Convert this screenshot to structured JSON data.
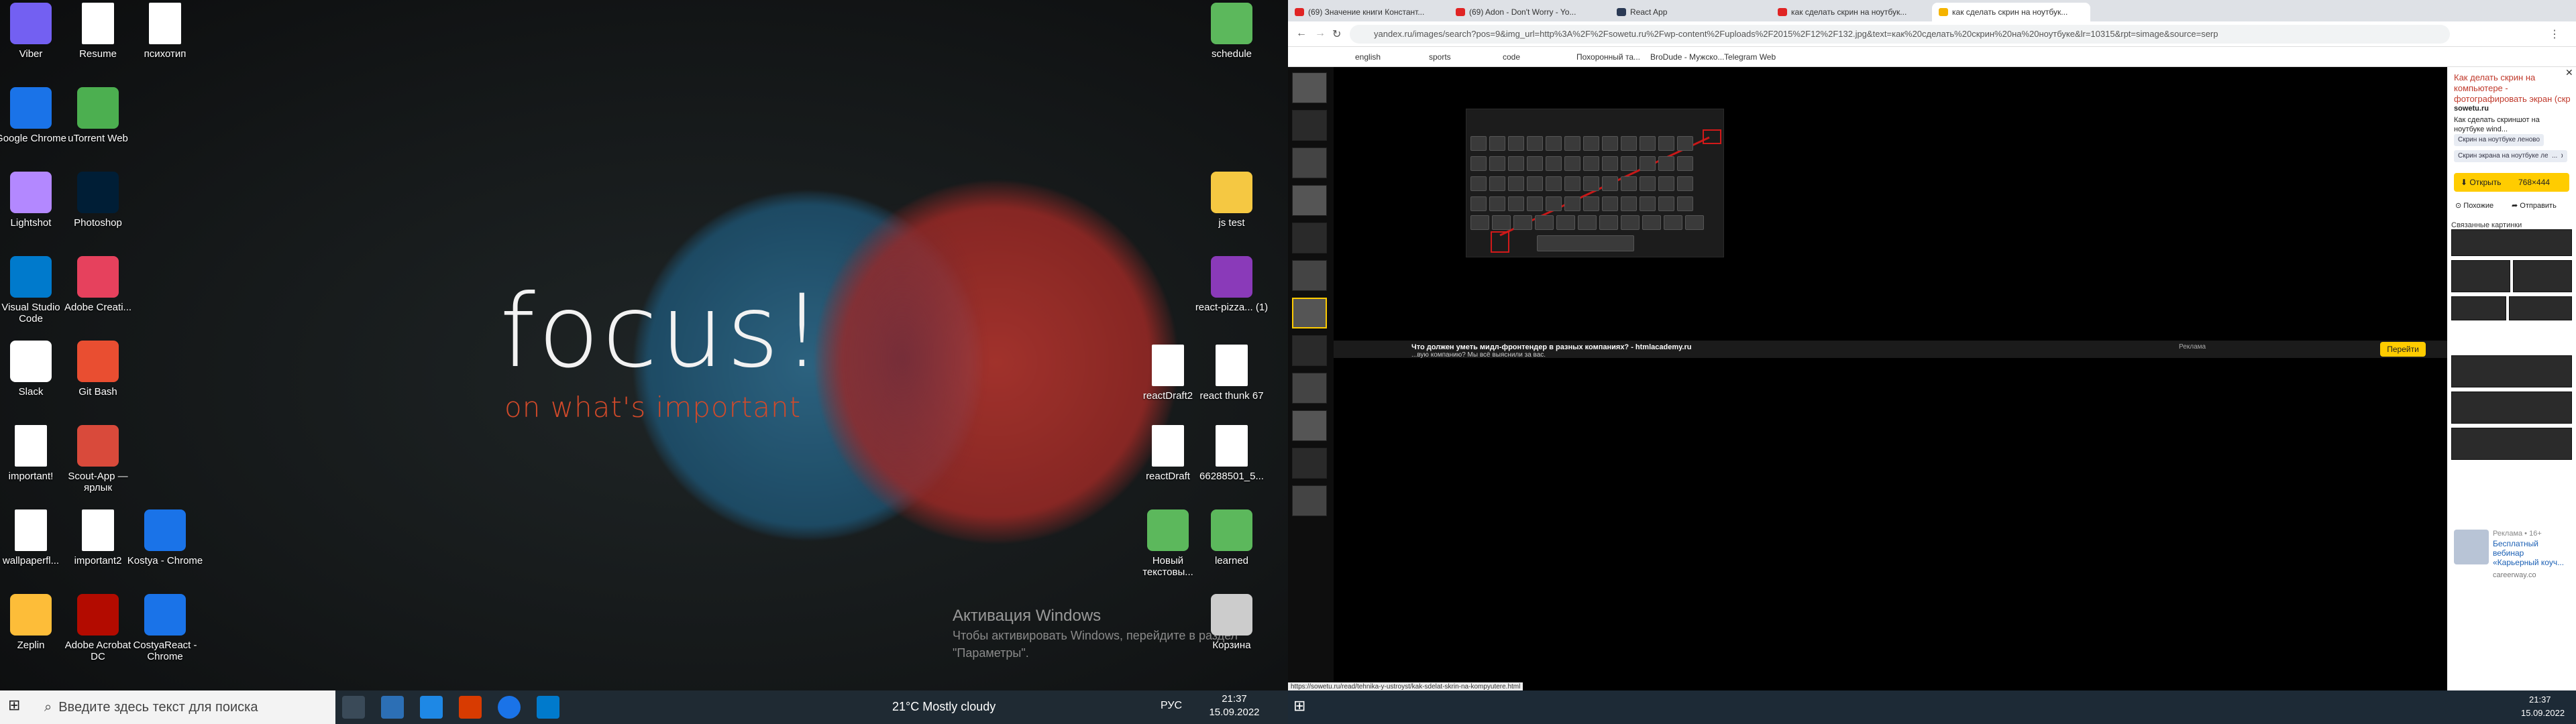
{
  "left_screen": {
    "wallpaper": {
      "title": "focus!",
      "subtitle": "on what's important"
    },
    "activation": {
      "title": "Активация Windows",
      "text": "Чтобы активировать Windows, перейдите в раздел \"Параметры\"."
    },
    "icons": [
      {
        "label": "Viber",
        "icon": "viber-icon",
        "color": "#7360f2"
      },
      {
        "label": "Resume",
        "icon": "docx-icon",
        "color": "#ffffff"
      },
      {
        "label": "психотип",
        "icon": "docx-icon",
        "color": "#ffffff"
      },
      {
        "label": "Google Chrome",
        "icon": "chrome-icon",
        "color": "#1a73e8"
      },
      {
        "label": "uTorrent Web",
        "icon": "utorrent-icon",
        "color": "#4caf50"
      },
      {
        "label": "Lightshot",
        "icon": "lightshot-icon",
        "color": "#b388ff"
      },
      {
        "label": "Photoshop",
        "icon": "photoshop-icon",
        "color": "#001e36"
      },
      {
        "label": "Visual Studio Code",
        "icon": "vscode-icon",
        "color": "#007acc"
      },
      {
        "label": "Adobe Creati...",
        "icon": "adobe-cc-icon",
        "color": "#e6415d"
      },
      {
        "label": "Slack",
        "icon": "slack-icon",
        "color": "#ffffff"
      },
      {
        "label": "Git Bash",
        "icon": "git-bash-icon",
        "color": "#e94e31"
      },
      {
        "label": "important!",
        "icon": "docx-icon",
        "color": "#ffffff"
      },
      {
        "label": "Scout-App — ярлык",
        "icon": "scout-app-icon",
        "color": "#d94a3b"
      },
      {
        "label": "wallpaperfl...",
        "icon": "image-file-icon",
        "color": "#ffffff"
      },
      {
        "label": "important2",
        "icon": "docx-icon",
        "color": "#ffffff"
      },
      {
        "label": "Kostya - Chrome",
        "icon": "chrome-icon",
        "color": "#1a73e8"
      },
      {
        "label": "Zeplin",
        "icon": "zeplin-icon",
        "color": "#fdbd39"
      },
      {
        "label": "Adobe Acrobat DC",
        "icon": "acrobat-icon",
        "color": "#b30b00"
      },
      {
        "label": "CostyaReact - Chrome",
        "icon": "chrome-icon",
        "color": "#1a73e8"
      },
      {
        "label": "schedule",
        "icon": "schedule-icon",
        "color": "#5cb85c"
      },
      {
        "label": "js test",
        "icon": "folder-icon",
        "color": "#f5c842"
      },
      {
        "label": "react-pizza... (1)",
        "icon": "rar-icon",
        "color": "#8a3ab9"
      },
      {
        "label": "reactDraft2",
        "icon": "docx-icon",
        "color": "#ffffff"
      },
      {
        "label": "react thunk 67",
        "icon": "docx-icon",
        "color": "#ffffff"
      },
      {
        "label": "reactDraft",
        "icon": "docx-icon",
        "color": "#ffffff"
      },
      {
        "label": "66288501_5...",
        "icon": "docx-icon",
        "color": "#ffffff"
      },
      {
        "label": "Новый текстовы...",
        "icon": "notepad-icon",
        "color": "#5cb85c"
      },
      {
        "label": "learned",
        "icon": "notepad-icon",
        "color": "#5cb85c"
      },
      {
        "label": "Корзина",
        "icon": "recycle-bin-icon",
        "color": "#cccccc"
      }
    ],
    "taskbar": {
      "search_placeholder": "Введите здесь текст для поиска",
      "weather": "21°C  Mostly cloudy",
      "lang": "РУС",
      "time": "21:37",
      "date": "15.09.2022"
    }
  },
  "right_screen": {
    "tabs": [
      {
        "label": "(69) Значение книги Констант..."
      },
      {
        "label": "(69) Adon - Don't Worry - Yo..."
      },
      {
        "label": "React App"
      },
      {
        "label": "как сделать скрин на ноутбук..."
      },
      {
        "label": "как сделать скрин на ноутбук...",
        "active": true
      }
    ],
    "address": "yandex.ru/images/search?pos=9&img_url=http%3A%2F%2Fsowetu.ru%2Fwp-content%2Fuploads%2F2015%2F12%2F132.jpg&text=как%20сделать%20скрин%20на%20ноутбуке&lr=10315&rpt=simage&source=serp",
    "bookmarks": [
      "english",
      "sports",
      "code",
      "Похоронный та...",
      "BroDude - Мужско...",
      "Telegram Web"
    ],
    "panel": {
      "title": "Как делать скрин на компьютере - фотографировать экран (скр",
      "site": "sowetu.ru",
      "desc": "Как сделать скриншот на ноутбуке wind...",
      "chips": [
        "Скрин на ноутбуке леново",
        "Скрин экрана на ноутбуке леново",
        "..."
      ],
      "open_label": "Открыть",
      "size": "768×444",
      "similar_label": "Похожие",
      "share_label": "Отправить",
      "related_label": "Связанные картинки",
      "ad_label": "Реклама • 16+",
      "ad_title": "Бесплатный вебинар «Карьерный коуч...",
      "ad_site": "careerway.co"
    },
    "notification": {
      "title": "Что должен уметь мидл-фронтендер в разных компаниях? - htmlacademy.ru",
      "ad": "Реклама",
      "text": "...вую компанию? Мы всё выяснили за вас.",
      "button": "Перейти"
    },
    "status_url": "https://sowetu.ru/read/tehnika-y-ustroyst/kak-sdelat-skrin-na-kompyutere.html",
    "taskbar": {
      "time": "21:37",
      "date": "15.09.2022"
    }
  }
}
